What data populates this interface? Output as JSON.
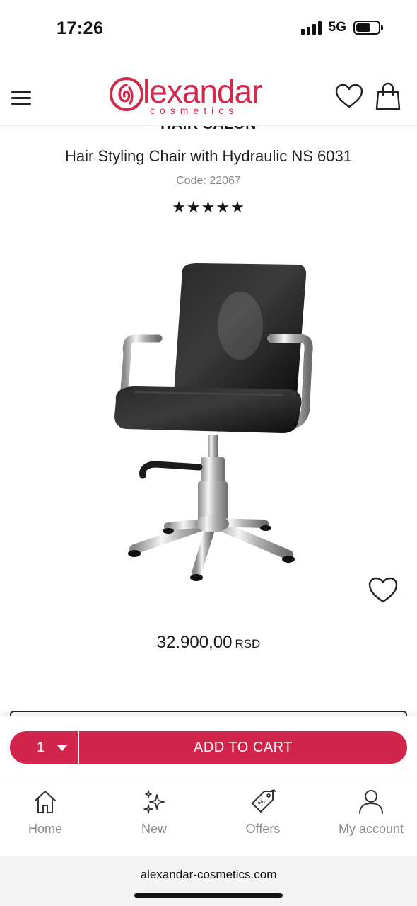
{
  "status_bar": {
    "time": "17:26",
    "network": "5G"
  },
  "brand": {
    "name": "lexandar",
    "tagline": "cosmetics",
    "color": "#d1254b"
  },
  "header": {
    "menu_icon": "hamburger-menu-icon",
    "wishlist_icon": "heart-icon",
    "cart_icon": "shopping-bag-icon"
  },
  "product": {
    "category": "HAIR SALON",
    "title": "Hair Styling Chair with Hydraulic NS 6031",
    "code": "Code: 22067",
    "rating_stars": "★★★★★",
    "rating_value": 5,
    "rating_max": 5,
    "price": "32.900,00",
    "currency": "RSD"
  },
  "cart": {
    "quantity": "1",
    "add_label": "ADD TO CART"
  },
  "nav": [
    {
      "label": "Home",
      "icon": "home-icon"
    },
    {
      "label": "New",
      "icon": "sparkles-icon"
    },
    {
      "label": "Offers",
      "icon": "price-tag-icon"
    },
    {
      "label": "My account",
      "icon": "user-icon"
    }
  ],
  "browser": {
    "url": "alexandar-cosmetics.com"
  }
}
